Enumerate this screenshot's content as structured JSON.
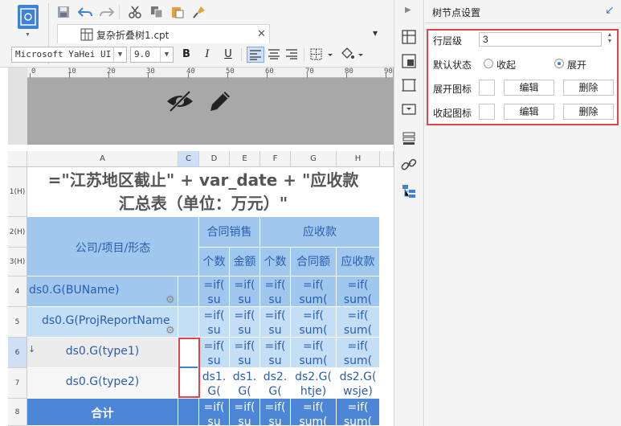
{
  "tab": {
    "filename": "复杂折叠树1.cpt"
  },
  "format": {
    "font_family": "Microsoft YaHei UI",
    "font_size": "9.0",
    "bold": "B",
    "italic": "I",
    "underline": "U"
  },
  "ruler": {
    "labels": [
      "0",
      "10",
      "20",
      "30",
      "40",
      "50",
      "60",
      "70",
      "80",
      "90"
    ]
  },
  "grid": {
    "columns": [
      "A",
      "C",
      "D",
      "E",
      "F",
      "G",
      "H"
    ],
    "rows": [
      "1(H)",
      "2(H)",
      "3(H)",
      "4",
      "5",
      "6",
      "7",
      "8"
    ],
    "title_line1": "=\"江苏地区截止\" + var_date + \"应收款",
    "title_line2": "汇总表（单位：万元）\"",
    "header_company": "公司/项目/形态",
    "header_contract_sales": "合同销售",
    "header_receivable": "应收款",
    "sub_count1": "个数",
    "sub_amount": "金额",
    "sub_count2": "个数",
    "sub_contract_amount": "合同额",
    "sub_receivable": "应收款",
    "r4_a": "ds0.G(BUName)",
    "r5_a": "ds0.G(ProjReportName",
    "r6_a": "ds0.G(type1)",
    "r7_a": "ds0.G(type2)",
    "r8_a": "合计",
    "f_if": "=if(",
    "f_su": "su",
    "f_sum": "sum(",
    "r7_d1": "ds1.",
    "r7_d2": "G(",
    "r7_e1": "ds1.",
    "r7_e2": "G(",
    "r7_f1": "ds2.",
    "r7_f2": "G(",
    "r7_g1": "ds2.G(",
    "r7_g2": "htje)",
    "r7_h1": "ds2.G(",
    "r7_h2": "wsje)"
  },
  "panel": {
    "title": "树节点设置",
    "level_label": "行层级",
    "level_value": "3",
    "default_state_label": "默认状态",
    "collapse_option": "收起",
    "expand_option": "展开",
    "expand_icon_label": "展开图标",
    "collapse_icon_label": "收起图标",
    "edit_label": "编辑",
    "delete_label": "删除"
  }
}
